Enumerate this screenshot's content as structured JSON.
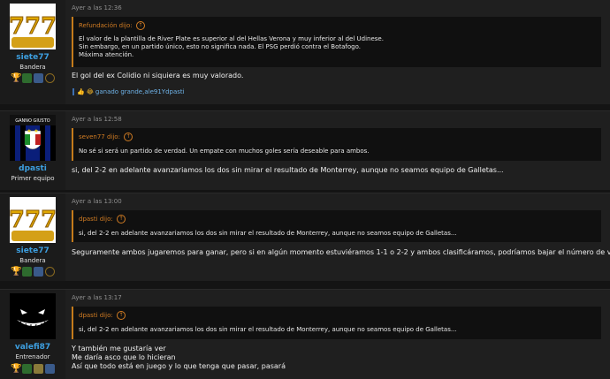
{
  "posts": [
    {
      "user": {
        "name": "siete77",
        "role": "Bandera",
        "avatar": "777-slot-icon",
        "avatar_text": "777"
      },
      "time": "Ayer a las 12:36",
      "quote": {
        "author": "Refundación dijo:",
        "lines": [
          "El valor de la plantilla de River Plate es superior al del Hellas Verona y muy inferior al del Udinese.",
          "Sin embargo, en un partido único, esto no significa nada. El PSG perdió contra el Botafogo.",
          "Máxima atención."
        ]
      },
      "message": [
        "El gol del ex Colidio ni siquiera es muy valorado."
      ],
      "reactions": "ganado grande,ale91Ydpasti"
    },
    {
      "user": {
        "name": "dpasti",
        "role": "Primer equipo",
        "avatar": "inter-shield-icon",
        "avatar_text": "GANNO GIUSTO"
      },
      "time": "Ayer a las 12:58",
      "quote": {
        "author": "seven77 dijo:",
        "lines": [
          "No sé si será un partido de verdad. Un empate con muchos goles sería deseable para ambos."
        ]
      },
      "message": [
        "si, del 2-2 en adelante avanzariamos los dos sin mirar el resultado de Monterrey, aunque no seamos equipo de Galletas..."
      ]
    },
    {
      "user": {
        "name": "siete77",
        "role": "Bandera",
        "avatar": "777-slot-icon",
        "avatar_text": "777"
      },
      "time": "Ayer a las 13:00",
      "quote": {
        "author": "dpasti dijo:",
        "lines": [
          "si, del 2-2 en adelante avanzariamos los dos sin mirar el resultado de Monterrey, aunque no seamos equipo de Galletas..."
        ]
      },
      "message": [
        "Seguramente ambos jugaremos para ganar, pero si en algún momento estuviéramos 1-1 o 2-2 y ambos clasificáramos, podríamos bajar el número de vueltas."
      ]
    },
    {
      "user": {
        "name": "valefi87",
        "role": "Entrenador",
        "avatar": "grin-face-icon"
      },
      "time": "Ayer a las 13:17",
      "quote": {
        "author": "dpasti dijo:",
        "lines": [
          "si, del 2-2 en adelante avanzariamos los dos sin mirar el resultado de Monterrey, aunque no seamos equipo de Galletas..."
        ]
      },
      "message": [
        "Y también me gustaría ver",
        "Me daría asco que lo hicieran",
        "Así que todo está en juego y lo que tenga que pasar, pasará"
      ]
    }
  ],
  "colors": {
    "accent": "#d17c23",
    "username": "#3d9fe0",
    "link": "#6fb3e8"
  }
}
